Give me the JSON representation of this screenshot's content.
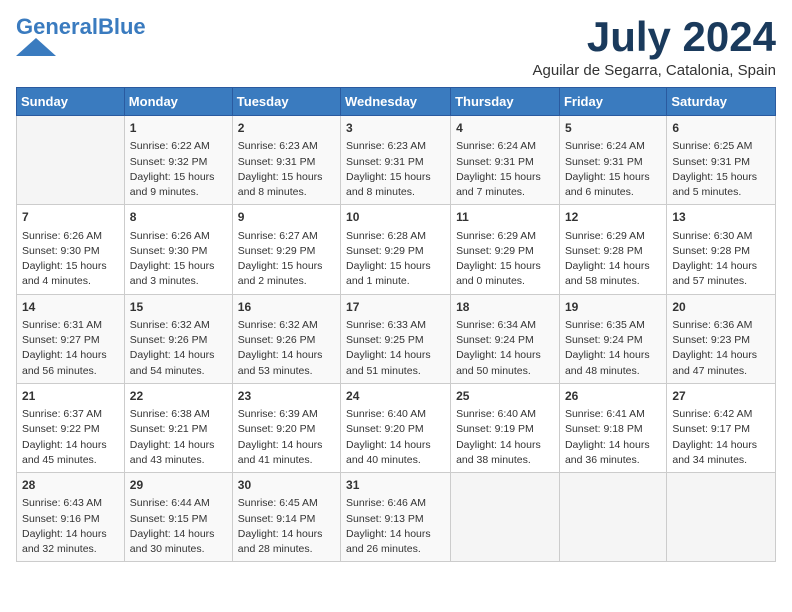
{
  "header": {
    "logo_line1": "General",
    "logo_line2": "Blue",
    "month": "July 2024",
    "location": "Aguilar de Segarra, Catalonia, Spain"
  },
  "weekdays": [
    "Sunday",
    "Monday",
    "Tuesday",
    "Wednesday",
    "Thursday",
    "Friday",
    "Saturday"
  ],
  "weeks": [
    [
      {
        "day": "",
        "info": ""
      },
      {
        "day": "1",
        "info": "Sunrise: 6:22 AM\nSunset: 9:32 PM\nDaylight: 15 hours\nand 9 minutes."
      },
      {
        "day": "2",
        "info": "Sunrise: 6:23 AM\nSunset: 9:31 PM\nDaylight: 15 hours\nand 8 minutes."
      },
      {
        "day": "3",
        "info": "Sunrise: 6:23 AM\nSunset: 9:31 PM\nDaylight: 15 hours\nand 8 minutes."
      },
      {
        "day": "4",
        "info": "Sunrise: 6:24 AM\nSunset: 9:31 PM\nDaylight: 15 hours\nand 7 minutes."
      },
      {
        "day": "5",
        "info": "Sunrise: 6:24 AM\nSunset: 9:31 PM\nDaylight: 15 hours\nand 6 minutes."
      },
      {
        "day": "6",
        "info": "Sunrise: 6:25 AM\nSunset: 9:31 PM\nDaylight: 15 hours\nand 5 minutes."
      }
    ],
    [
      {
        "day": "7",
        "info": "Sunrise: 6:26 AM\nSunset: 9:30 PM\nDaylight: 15 hours\nand 4 minutes."
      },
      {
        "day": "8",
        "info": "Sunrise: 6:26 AM\nSunset: 9:30 PM\nDaylight: 15 hours\nand 3 minutes."
      },
      {
        "day": "9",
        "info": "Sunrise: 6:27 AM\nSunset: 9:29 PM\nDaylight: 15 hours\nand 2 minutes."
      },
      {
        "day": "10",
        "info": "Sunrise: 6:28 AM\nSunset: 9:29 PM\nDaylight: 15 hours\nand 1 minute."
      },
      {
        "day": "11",
        "info": "Sunrise: 6:29 AM\nSunset: 9:29 PM\nDaylight: 15 hours\nand 0 minutes."
      },
      {
        "day": "12",
        "info": "Sunrise: 6:29 AM\nSunset: 9:28 PM\nDaylight: 14 hours\nand 58 minutes."
      },
      {
        "day": "13",
        "info": "Sunrise: 6:30 AM\nSunset: 9:28 PM\nDaylight: 14 hours\nand 57 minutes."
      }
    ],
    [
      {
        "day": "14",
        "info": "Sunrise: 6:31 AM\nSunset: 9:27 PM\nDaylight: 14 hours\nand 56 minutes."
      },
      {
        "day": "15",
        "info": "Sunrise: 6:32 AM\nSunset: 9:26 PM\nDaylight: 14 hours\nand 54 minutes."
      },
      {
        "day": "16",
        "info": "Sunrise: 6:32 AM\nSunset: 9:26 PM\nDaylight: 14 hours\nand 53 minutes."
      },
      {
        "day": "17",
        "info": "Sunrise: 6:33 AM\nSunset: 9:25 PM\nDaylight: 14 hours\nand 51 minutes."
      },
      {
        "day": "18",
        "info": "Sunrise: 6:34 AM\nSunset: 9:24 PM\nDaylight: 14 hours\nand 50 minutes."
      },
      {
        "day": "19",
        "info": "Sunrise: 6:35 AM\nSunset: 9:24 PM\nDaylight: 14 hours\nand 48 minutes."
      },
      {
        "day": "20",
        "info": "Sunrise: 6:36 AM\nSunset: 9:23 PM\nDaylight: 14 hours\nand 47 minutes."
      }
    ],
    [
      {
        "day": "21",
        "info": "Sunrise: 6:37 AM\nSunset: 9:22 PM\nDaylight: 14 hours\nand 45 minutes."
      },
      {
        "day": "22",
        "info": "Sunrise: 6:38 AM\nSunset: 9:21 PM\nDaylight: 14 hours\nand 43 minutes."
      },
      {
        "day": "23",
        "info": "Sunrise: 6:39 AM\nSunset: 9:20 PM\nDaylight: 14 hours\nand 41 minutes."
      },
      {
        "day": "24",
        "info": "Sunrise: 6:40 AM\nSunset: 9:20 PM\nDaylight: 14 hours\nand 40 minutes."
      },
      {
        "day": "25",
        "info": "Sunrise: 6:40 AM\nSunset: 9:19 PM\nDaylight: 14 hours\nand 38 minutes."
      },
      {
        "day": "26",
        "info": "Sunrise: 6:41 AM\nSunset: 9:18 PM\nDaylight: 14 hours\nand 36 minutes."
      },
      {
        "day": "27",
        "info": "Sunrise: 6:42 AM\nSunset: 9:17 PM\nDaylight: 14 hours\nand 34 minutes."
      }
    ],
    [
      {
        "day": "28",
        "info": "Sunrise: 6:43 AM\nSunset: 9:16 PM\nDaylight: 14 hours\nand 32 minutes."
      },
      {
        "day": "29",
        "info": "Sunrise: 6:44 AM\nSunset: 9:15 PM\nDaylight: 14 hours\nand 30 minutes."
      },
      {
        "day": "30",
        "info": "Sunrise: 6:45 AM\nSunset: 9:14 PM\nDaylight: 14 hours\nand 28 minutes."
      },
      {
        "day": "31",
        "info": "Sunrise: 6:46 AM\nSunset: 9:13 PM\nDaylight: 14 hours\nand 26 minutes."
      },
      {
        "day": "",
        "info": ""
      },
      {
        "day": "",
        "info": ""
      },
      {
        "day": "",
        "info": ""
      }
    ]
  ]
}
